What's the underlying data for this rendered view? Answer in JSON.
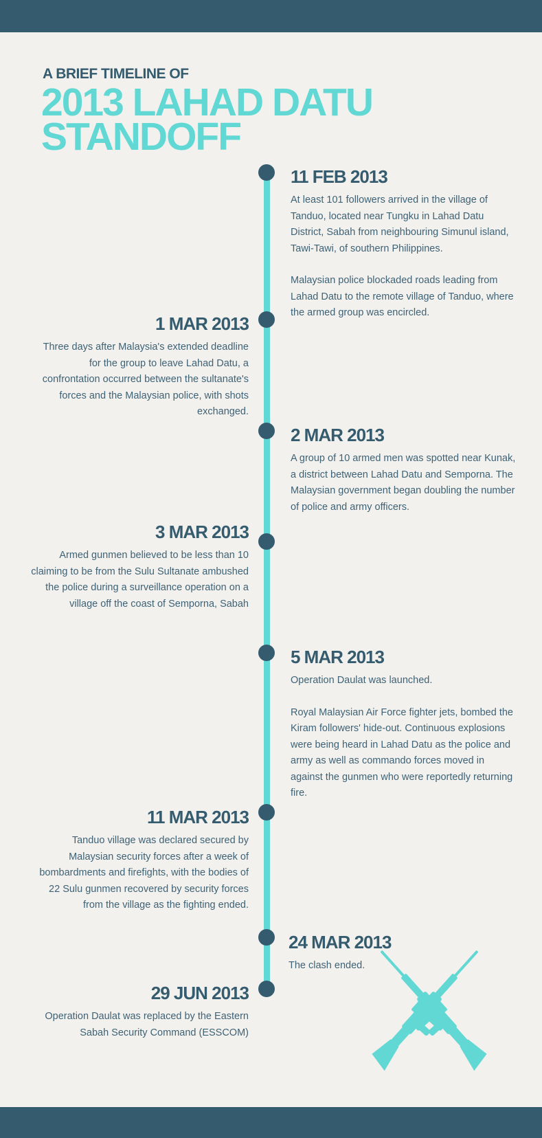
{
  "header": {
    "kicker": "A BRIEF TIMELINE OF",
    "title": "2013 LAHAD DATU STANDOFF"
  },
  "colors": {
    "band": "#345b6e",
    "accent": "#62d8d4",
    "background": "#f3f1ed"
  },
  "events": [
    {
      "date": "11 FEB 2013",
      "paragraphs": [
        "At least 101 followers arrived in the village of Tanduo, located near Tungku in Lahad Datu District, Sabah from neighbouring Simunul island, Tawi-Tawi, of southern Philippines.",
        "Malaysian police blockaded roads leading from Lahad Datu to the remote village of Tanduo, where the armed group was encircled."
      ]
    },
    {
      "date": "1 MAR 2013",
      "paragraphs": [
        "Three days after Malaysia's extended deadline for the group to leave Lahad Datu, a confrontation occurred between the sultanate's forces and the Malaysian police, with shots exchanged."
      ]
    },
    {
      "date": "2 MAR 2013",
      "paragraphs": [
        "A group of 10 armed men was spotted near Kunak, a district between Lahad Datu and Semporna. The Malaysian government began doubling the number of police and army officers."
      ]
    },
    {
      "date": "3 MAR 2013",
      "paragraphs": [
        "Armed gunmen believed to be less than 10 claiming to be from the Sulu Sultanate ambushed the police during a surveillance operation on a village off the coast of Semporna, Sabah"
      ]
    },
    {
      "date": "5 MAR 2013",
      "paragraphs": [
        "Operation Daulat was launched.",
        "Royal Malaysian Air Force fighter jets, bombed the Kiram followers' hide-out. Continuous explosions were being heard in Lahad Datu as the police and army as well as commando forces moved in against the gunmen who were reportedly returning fire."
      ]
    },
    {
      "date": "11 MAR 2013",
      "paragraphs": [
        "Tanduo village was declared secured by Malaysian security forces after a week of bombardments and firefights, with the bodies of 22 Sulu gunmen recovered by security forces from the village as the fighting ended."
      ]
    },
    {
      "date": "24 MAR 2013",
      "paragraphs": [
        "The clash ended."
      ]
    },
    {
      "date": "29 JUN 2013",
      "paragraphs": [
        "Operation Daulat was replaced by the Eastern Sabah Security Command (ESSCOM)"
      ]
    }
  ],
  "decoration": {
    "icon": "crossed-rifles-icon"
  }
}
